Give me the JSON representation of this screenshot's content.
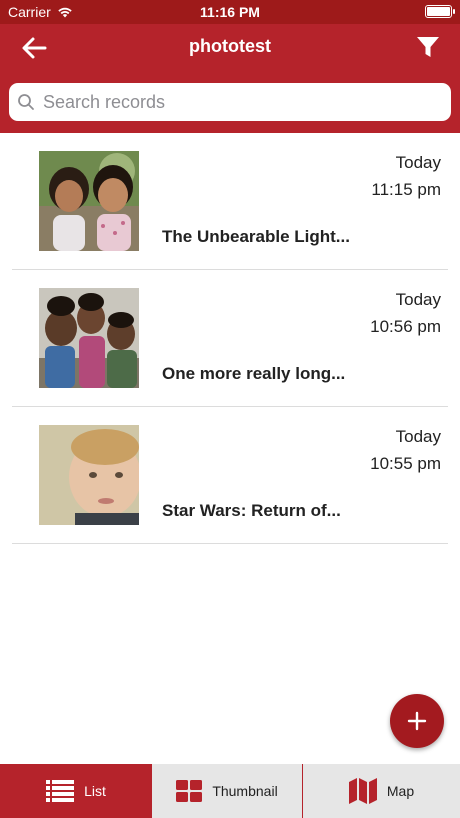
{
  "status_bar": {
    "carrier": "Carrier",
    "time": "11:16 PM"
  },
  "header": {
    "title": "phototest",
    "back_icon": "arrow-left-icon",
    "filter_icon": "filter-funnel-icon"
  },
  "search": {
    "placeholder": "Search records"
  },
  "records": [
    {
      "date": "Today",
      "time": "11:15 pm",
      "name": "The Unbearable Light...",
      "photo": "two-girls-smiling"
    },
    {
      "date": "Today",
      "time": "10:56 pm",
      "name": "One more really long...",
      "photo": "group-of-kids"
    },
    {
      "date": "Today",
      "time": "10:55 pm",
      "name": "Star Wars: Return of...",
      "photo": "toddler-portrait"
    }
  ],
  "fab": {
    "icon": "plus-icon"
  },
  "tabs": {
    "list_label": "List",
    "thumbnail_label": "Thumbnail",
    "map_label": "Map",
    "active": "list"
  },
  "colors": {
    "primary": "#b5232b",
    "status_bar": "#9e1a1a",
    "fab": "#a31a1f",
    "tab_inactive_bg": "#e6e6e6"
  }
}
